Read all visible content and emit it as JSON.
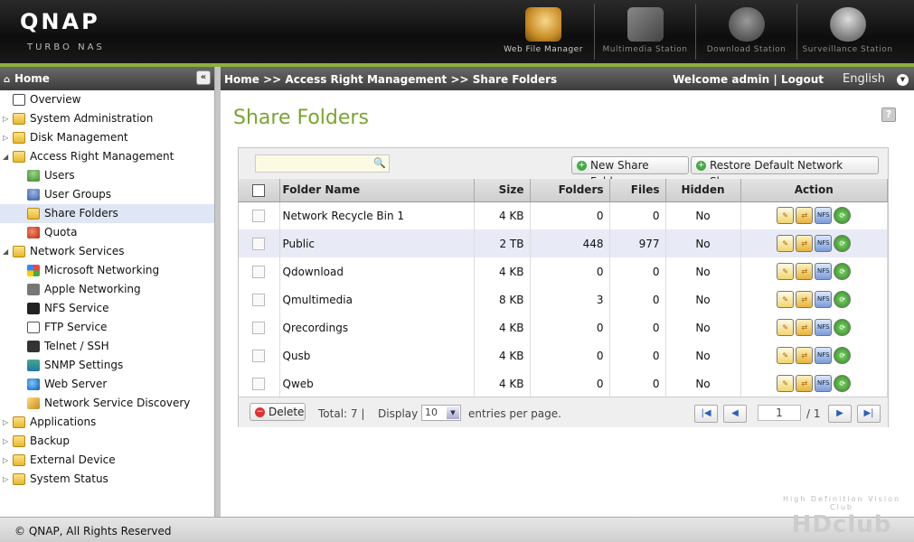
{
  "header": {
    "logo": "QNAP",
    "sublogo": "TURBO NAS",
    "apps": [
      {
        "label": "Web File Manager",
        "icon": "web-file-manager-icon"
      },
      {
        "label": "Multimedia Station",
        "icon": "multimedia-station-icon"
      },
      {
        "label": "Download Station",
        "icon": "download-station-icon"
      },
      {
        "label": "Surveillance Station",
        "icon": "surveillance-station-icon"
      }
    ]
  },
  "sidebar": {
    "title": "Home",
    "items": [
      {
        "label": "Overview",
        "icon": "overview-icon"
      },
      {
        "label": "System Administration",
        "icon": "folder-icon"
      },
      {
        "label": "Disk Management",
        "icon": "folder-icon"
      },
      {
        "label": "Access Right Management",
        "icon": "folder-icon"
      },
      {
        "label": "Users",
        "icon": "user-icon"
      },
      {
        "label": "User Groups",
        "icon": "user-group-icon"
      },
      {
        "label": "Share Folders",
        "icon": "share-folder-icon"
      },
      {
        "label": "Quota",
        "icon": "quota-icon"
      },
      {
        "label": "Network Services",
        "icon": "folder-icon"
      },
      {
        "label": "Microsoft Networking",
        "icon": "windows-icon"
      },
      {
        "label": "Apple Networking",
        "icon": "apple-icon"
      },
      {
        "label": "NFS Service",
        "icon": "linux-icon"
      },
      {
        "label": "FTP Service",
        "icon": "ftp-icon"
      },
      {
        "label": "Telnet / SSH",
        "icon": "terminal-icon"
      },
      {
        "label": "SNMP Settings",
        "icon": "snmp-icon"
      },
      {
        "label": "Web Server",
        "icon": "globe-icon"
      },
      {
        "label": "Network Service Discovery",
        "icon": "discovery-icon"
      },
      {
        "label": "Applications",
        "icon": "folder-icon"
      },
      {
        "label": "Backup",
        "icon": "folder-icon"
      },
      {
        "label": "External Device",
        "icon": "folder-icon"
      },
      {
        "label": "System Status",
        "icon": "folder-icon"
      }
    ]
  },
  "topbar": {
    "crumb_home": "Home",
    "crumb_sep1": ">>",
    "crumb_arm": "Access Right Management",
    "crumb_sep2": ">>",
    "crumb_current": "Share Folders",
    "welcome": "Welcome admin",
    "sep": "|",
    "logout": "Logout",
    "language": "English"
  },
  "page": {
    "title": "Share Folders",
    "new_button": "New Share Folder",
    "restore_button": "Restore Default Network Shares",
    "delete_button": "Delete"
  },
  "table": {
    "columns": [
      "Folder Name",
      "Size",
      "Folders",
      "Files",
      "Hidden",
      "Action"
    ],
    "rows": [
      {
        "name": "Network Recycle Bin 1",
        "size": "4 KB",
        "folders": "0",
        "files": "0",
        "hidden": "No"
      },
      {
        "name": "Public",
        "size": "2 TB",
        "folders": "448",
        "files": "977",
        "hidden": "No"
      },
      {
        "name": "Qdownload",
        "size": "4 KB",
        "folders": "0",
        "files": "0",
        "hidden": "No"
      },
      {
        "name": "Qmultimedia",
        "size": "8 KB",
        "folders": "3",
        "files": "0",
        "hidden": "No"
      },
      {
        "name": "Qrecordings",
        "size": "4 KB",
        "folders": "0",
        "files": "0",
        "hidden": "No"
      },
      {
        "name": "Qusb",
        "size": "4 KB",
        "folders": "0",
        "files": "0",
        "hidden": "No"
      },
      {
        "name": "Qweb",
        "size": "4 KB",
        "folders": "0",
        "files": "0",
        "hidden": "No"
      }
    ]
  },
  "pager": {
    "total": "Total: 7",
    "sep": "|",
    "display": "Display",
    "page_size": "10",
    "entries": "entries per page.",
    "page": "1",
    "of": "/ 1"
  },
  "footer": {
    "copyright": "© QNAP, All Rights Reserved"
  },
  "watermark": {
    "top": "High Definition Vision Club",
    "big": "HDclub"
  }
}
